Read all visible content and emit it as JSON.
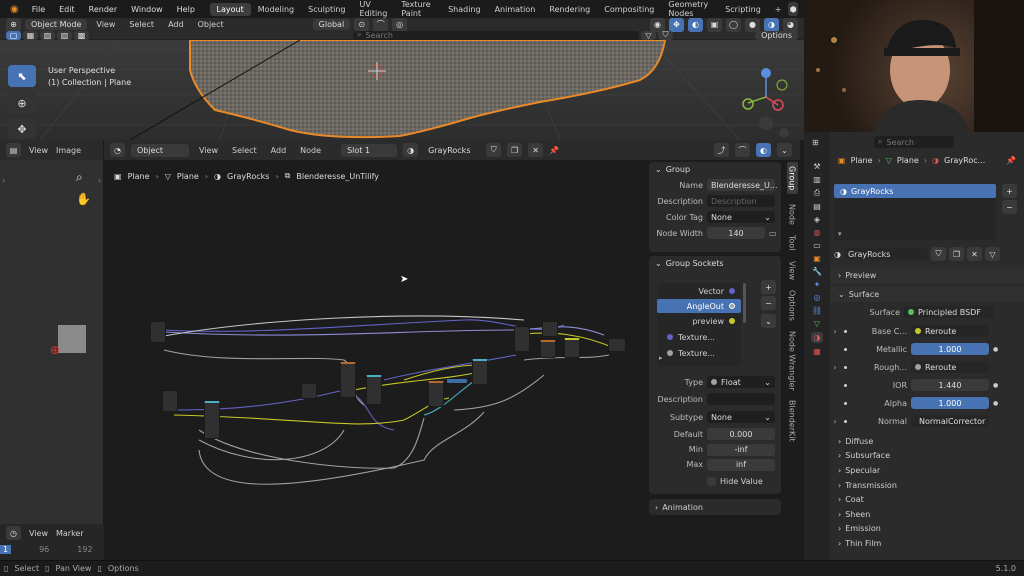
{
  "menubar": {
    "menus": [
      "File",
      "Edit",
      "Render",
      "Window",
      "Help"
    ],
    "workspaces": [
      "Layout",
      "Modeling",
      "Sculpting",
      "UV Editing",
      "Texture Paint",
      "Shading",
      "Animation",
      "Rendering",
      "Compositing",
      "Geometry Nodes",
      "Scripting"
    ],
    "active_workspace": "Layout",
    "add_tab": "+"
  },
  "viewport": {
    "mode": "Object Mode",
    "menus": [
      "View",
      "Select",
      "Add",
      "Object"
    ],
    "transform": "Global",
    "search_placeholder": "Search",
    "options": "Options",
    "overlay_line1": "User Perspective",
    "overlay_line2": "(1) Collection | Plane"
  },
  "image_editor": {
    "menus": [
      "View",
      "Image"
    ]
  },
  "timeline": {
    "menus": [
      "View",
      "Marker"
    ],
    "frames": [
      "1",
      "96",
      "192"
    ]
  },
  "node_editor": {
    "editor_type": "Object",
    "menus": [
      "View",
      "Select",
      "Add",
      "Node"
    ],
    "slot": "Slot 1",
    "material": "GrayRocks",
    "breadcrumb": [
      "Plane",
      "Plane",
      "GrayRocks",
      "Blenderesse_UnTilify"
    ],
    "side_tabs": [
      "Group",
      "Node",
      "Tool",
      "View",
      "Options",
      "Node Wrangler",
      "BlenderKit"
    ]
  },
  "group_panel": {
    "title": "Group",
    "name_label": "Name",
    "name_value": "Blenderesse_U...",
    "description_label": "Description",
    "description_placeholder": "Description",
    "color_tag_label": "Color Tag",
    "color_tag_value": "None",
    "node_width_label": "Node Width",
    "node_width_value": "140"
  },
  "sockets_panel": {
    "title": "Group Sockets",
    "sockets": [
      {
        "name": "Vector",
        "color": "#6363c7"
      },
      {
        "name": "AngleOut",
        "color": "#a1a1a1"
      },
      {
        "name": "preview",
        "color": "#c7c729"
      },
      {
        "name": "Texture...",
        "color": "#6363c7"
      },
      {
        "name": "Texture...",
        "color": "#a1a1a1"
      }
    ],
    "selected_index": 1,
    "type_label": "Type",
    "type_value": "Float",
    "description_label": "Description",
    "subtype_label": "Subtype",
    "subtype_value": "None",
    "default_label": "Default",
    "default_value": "0.000",
    "min_label": "Min",
    "min_value": "-inf",
    "max_label": "Max",
    "max_value": "inf",
    "hide_value_label": "Hide Value",
    "animation_label": "Animation"
  },
  "properties": {
    "search_placeholder": "Search",
    "breadcrumb": [
      "Plane",
      "Plane",
      "GrayRoc..."
    ],
    "material_slot": "GrayRocks",
    "material_name": "GrayRocks",
    "preview_label": "Preview",
    "surface_section": "Surface",
    "surface_label": "Surface",
    "surface_value": "Principled BSDF",
    "rows": [
      {
        "label": "Base C...",
        "value": "Reroute",
        "kind": "link",
        "sock": "#c7c729"
      },
      {
        "label": "Metallic",
        "value": "1.000",
        "kind": "slider",
        "sock": "#a1a1a1"
      },
      {
        "label": "Rough...",
        "value": "Reroute",
        "kind": "link",
        "sock": "#a1a1a1"
      },
      {
        "label": "IOR",
        "value": "1.440",
        "kind": "number",
        "sock": "#a1a1a1"
      },
      {
        "label": "Alpha",
        "value": "1.000",
        "kind": "slider",
        "sock": "#a1a1a1"
      },
      {
        "label": "Normal",
        "value": "NormalCorrector",
        "kind": "link",
        "sock": "#6363c7"
      }
    ],
    "subsections": [
      "Diffuse",
      "Subsurface",
      "Specular",
      "Transmission",
      "Coat",
      "Sheen",
      "Emission",
      "Thin Film"
    ]
  },
  "statusbar": {
    "items": [
      "Select",
      "Pan View",
      "Options"
    ],
    "version": "5.1.0"
  },
  "colors": {
    "accent": "#4772b3",
    "outline_orange": "#e8892a"
  }
}
